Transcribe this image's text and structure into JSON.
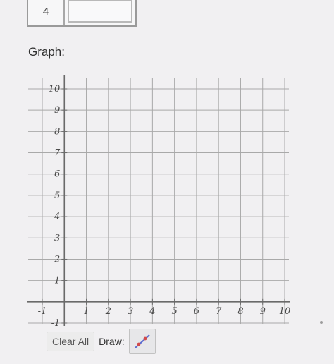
{
  "table": {
    "value": "4",
    "input_value": ""
  },
  "graph": {
    "label": "Graph:",
    "x_ticks": [
      "-1",
      "1",
      "2",
      "3",
      "4",
      "5",
      "6",
      "7",
      "8",
      "9",
      "10"
    ],
    "y_ticks": [
      "10",
      "9",
      "8",
      "7",
      "6",
      "5",
      "4",
      "3",
      "2",
      "1",
      "-1"
    ],
    "x_range": [
      -1,
      10
    ],
    "y_range": [
      -1,
      10
    ]
  },
  "toolbar": {
    "clear_label": "Clear All",
    "draw_label": "Draw:",
    "draw_tool_icon": "line-segment-icon"
  },
  "colors": {
    "grid": "#a9a9a9",
    "axis": "#6a6a6a",
    "tool_point": "#d24a4a",
    "tool_line": "#5b6ad0"
  }
}
